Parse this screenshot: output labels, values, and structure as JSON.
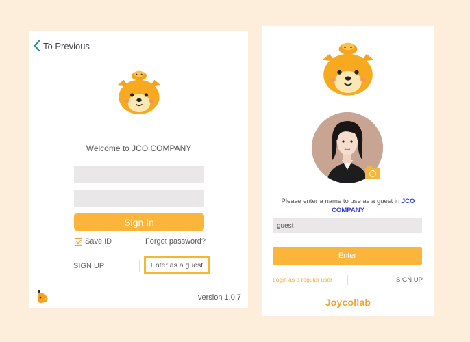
{
  "login": {
    "back_label": "To Previous",
    "welcome": "Welcome to JCO COMPANY",
    "id_placeholder": "",
    "password_placeholder": "",
    "signin_label": "Sign In",
    "save_id_label": "Save ID",
    "save_id_checked": true,
    "forgot_label": "Forgot password?",
    "signup_label": "SIGN UP",
    "guest_label": "Enter as a guest",
    "version": "version 1.0.7"
  },
  "guest": {
    "prompt_text": "Please enter a name to use as a guest in ",
    "prompt_company": "JCO COMPANY",
    "name_value": "guest",
    "enter_label": "Enter",
    "login_regular_label": "Login as a regular user",
    "signup_label": "SIGN UP",
    "brand": "Joycollab"
  },
  "colors": {
    "background": "#fdeedb",
    "accent": "#fbb53b",
    "guest_highlight": "#f6b62f",
    "company_blue": "#2c3bd4"
  },
  "icons": [
    "chevron-left-icon",
    "bear-mascot-icon",
    "camera-icon",
    "joycollab-logo-icon"
  ]
}
